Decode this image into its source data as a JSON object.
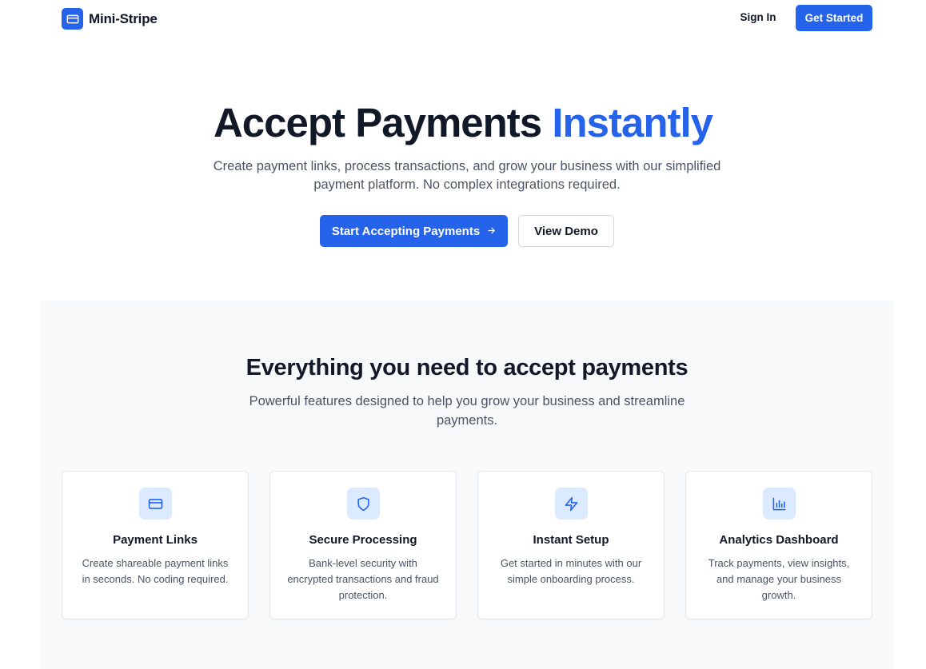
{
  "header": {
    "brand_name": "Mini-Stripe",
    "brand_icon": "credit-card-icon",
    "signin_label": "Sign In",
    "get_started_label": "Get Started"
  },
  "hero": {
    "title_main": "Accept Payments ",
    "title_accent": "Instantly",
    "subtitle": "Create payment links, process transactions, and grow your business with our simplified payment platform. No complex integrations required.",
    "primary_cta": "Start Accepting Payments",
    "primary_cta_icon": "arrow-right-icon",
    "secondary_cta": "View Demo"
  },
  "features": {
    "title": "Everything you need to accept payments",
    "subtitle": "Powerful features designed to help you grow your business and streamline payments.",
    "cards": [
      {
        "icon": "credit-card-icon",
        "title": "Payment Links",
        "description": "Create shareable payment links in seconds. No coding required."
      },
      {
        "icon": "shield-icon",
        "title": "Secure Processing",
        "description": "Bank-level security with encrypted transactions and fraud protection."
      },
      {
        "icon": "lightning-icon",
        "title": "Instant Setup",
        "description": "Get started in minutes with our simple onboarding process."
      },
      {
        "icon": "bar-chart-icon",
        "title": "Analytics Dashboard",
        "description": "Track payments, view insights, and manage your business growth."
      }
    ]
  },
  "colors": {
    "accent": "#2563eb",
    "icon_bg": "#dbeafe",
    "text_dark": "#111827",
    "text_muted": "#4b5563",
    "section_bg": "#f8f9fb"
  }
}
